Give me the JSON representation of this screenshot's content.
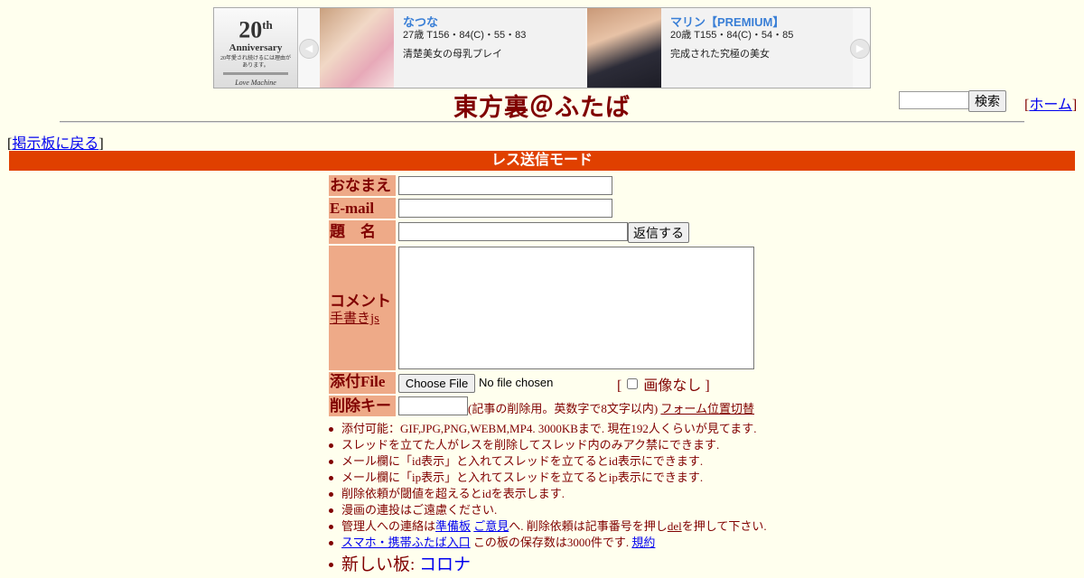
{
  "banner": {
    "logo": {
      "line1": "20",
      "line1_sup": "th",
      "line2": "Anniversary",
      "line3": "20年愛され続けるには理由があります。",
      "signature": "Love Machine"
    },
    "cards": [
      {
        "name": "なつな",
        "stats": "27歳 T156・84(C)・55・83",
        "desc": "清楚美女の母乳プレイ"
      },
      {
        "name": "マリン【PREMIUM】",
        "stats": "20歳 T155・84(C)・54・85",
        "desc": "完成された究極の美女"
      }
    ]
  },
  "header": {
    "title": "東方裏＠ふたば",
    "search_button": "検索",
    "home_open": "[",
    "home_label": "ホーム",
    "home_close": "]",
    "back_open": "[",
    "back_label": "掲示板に戻る",
    "back_close": "]"
  },
  "mode_bar": "レス送信モード",
  "form": {
    "name_label": "おなまえ",
    "email_label": "E-mail",
    "subject_label": "題　名",
    "submit_label": "返信する",
    "comment_label": "コメント",
    "handwriting_link": "手書きjs",
    "file_label": "添付File",
    "choose_file": "Choose File",
    "no_file": "No file chosen",
    "no_image_open": "[",
    "no_image_label": "画像なし",
    "no_image_close": "]",
    "delkey_label": "削除キー",
    "delkey_note": "(記事の削除用。英数字で8文字以内)",
    "form_position_link": "フォーム位置切替"
  },
  "notes": {
    "n1": "添付可能：GIF,JPG,PNG,WEBM,MP4. 3000KBまで. 現在192人くらいが見てます.",
    "n2": "スレッドを立てた人がレスを削除してスレッド内のみアク禁にできます.",
    "n3": "メール欄に「id表示」と入れてスレッドを立てるとid表示にできます.",
    "n4": "メール欄に「ip表示」と入れてスレッドを立てるとip表示にできます.",
    "n5": "削除依頼が閾値を超えるとidを表示します.",
    "n6": "漫画の連投はご遠慮ください.",
    "n7_prefix": "管理人への連絡は",
    "n7_link1": "準備板",
    "n7_link2": "ご意見",
    "n7_mid": "へ. 削除依頼は記事番号を押し",
    "n7_link3": "del",
    "n7_suffix": "を押して下さい.",
    "n8_link1": "スマホ・携帯ふたば入口",
    "n8_mid": "この板の保存数は3000件です.",
    "n8_link2": "規約",
    "n9_prefix": "新しい板: ",
    "n9_link": "コロナ"
  }
}
